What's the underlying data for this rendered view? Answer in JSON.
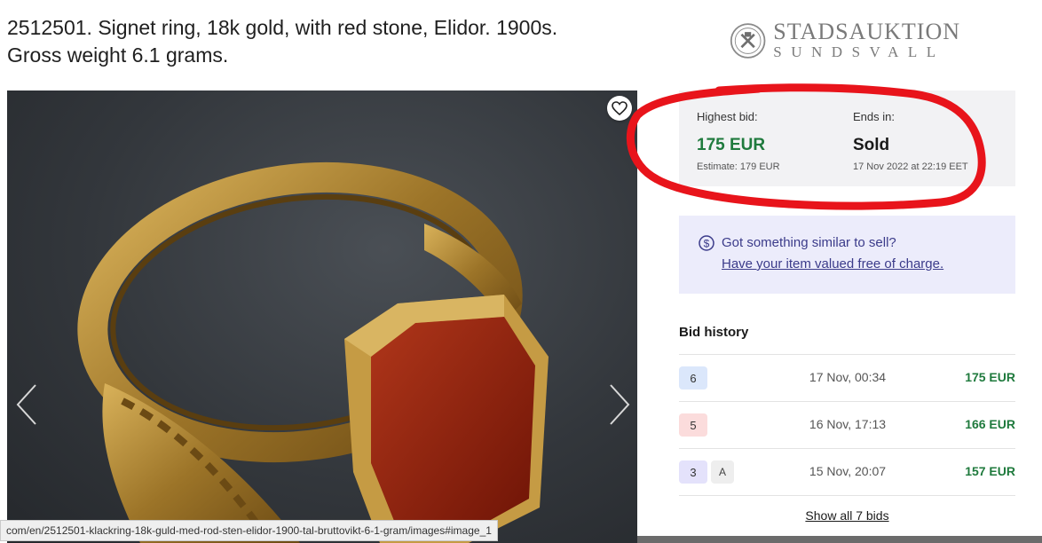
{
  "header": {
    "title_line1": "2512501. Signet ring, 18k gold, with red stone, Elidor. 1900s.",
    "title_line2": "Gross weight 6.1 grams."
  },
  "logo": {
    "name": "STADSAUKTION",
    "city": "SUNDSVALL"
  },
  "gallery": {
    "favorite_icon": "heart-icon",
    "prev_icon": "chevron-left-icon",
    "next_icon": "chevron-right-icon",
    "status_url": "com/en/2512501-klackring-18k-guld-med-rod-sten-elidor-1900-tal-bruttovikt-6-1-gram/images#image_1"
  },
  "bid_summary": {
    "highest_label": "Highest bid:",
    "highest_value": "175 EUR",
    "estimate": "Estimate: 179 EUR",
    "ends_label": "Ends in:",
    "ends_value": "Sold",
    "ends_date": "17 Nov 2022 at 22:19 EET"
  },
  "sell_promo": {
    "icon": "dollar-circle-icon",
    "question": "Got something similar to sell?",
    "link": "Have your item valued free of charge."
  },
  "bid_history": {
    "title": "Bid history",
    "rows": [
      {
        "bidder": "6",
        "tag": "",
        "time": "17 Nov, 00:34",
        "amount": "175 EUR"
      },
      {
        "bidder": "5",
        "tag": "",
        "time": "16 Nov, 17:13",
        "amount": "166 EUR"
      },
      {
        "bidder": "3",
        "tag": "A",
        "time": "15 Nov, 20:07",
        "amount": "157 EUR"
      }
    ],
    "show_all": "Show all 7 bids"
  },
  "colors": {
    "accent_green": "#1f7a3d",
    "promo_bg": "#ececfb",
    "promo_text": "#3b3b8a",
    "annotation_red": "#e8141b"
  }
}
